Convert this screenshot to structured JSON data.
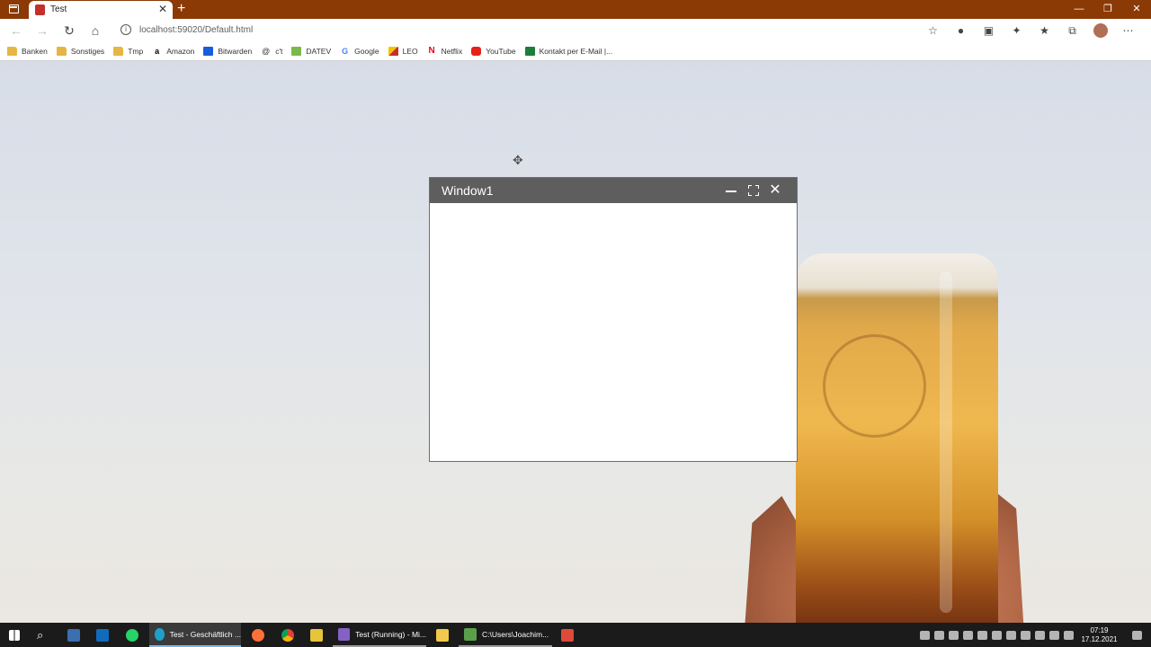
{
  "browser": {
    "tab_title": "Test",
    "tab_close": "✕",
    "new_tab": "+",
    "url": "localhost:59020/Default.html",
    "window_controls": {
      "minimize": "—",
      "restore": "❐",
      "close": "✕"
    }
  },
  "bookmarks": [
    {
      "label": "Banken",
      "icon": "folder-icon"
    },
    {
      "label": "Sonstiges",
      "icon": "folder-icon"
    },
    {
      "label": "Tmp",
      "icon": "folder-icon"
    },
    {
      "label": "Amazon",
      "icon": "amazon-icon"
    },
    {
      "label": "Bitwarden",
      "icon": "bitwarden-icon"
    },
    {
      "label": "c't",
      "icon": "at-icon"
    },
    {
      "label": "DATEV",
      "icon": "datev-icon"
    },
    {
      "label": "Google",
      "icon": "google-icon"
    },
    {
      "label": "LEO",
      "icon": "leo-icon"
    },
    {
      "label": "Netflix",
      "icon": "netflix-icon"
    },
    {
      "label": "YouTube",
      "icon": "youtube-icon"
    },
    {
      "label": "Kontakt per E-Mail |...",
      "icon": "excel-icon"
    }
  ],
  "window": {
    "title": "Window1",
    "minimize": "",
    "maximize": "",
    "close": "✕"
  },
  "taskbar": {
    "items": [
      {
        "label": "Test - Geschäftlich ...",
        "icon": "edge-icon"
      },
      {
        "label": "Test (Running) - Mi...",
        "icon": "visual-studio-icon"
      },
      {
        "label": "C:\\Users\\Joachim...",
        "icon": "notepad-icon"
      }
    ],
    "clock_time": "07:19",
    "clock_date": "17.12.2021"
  }
}
